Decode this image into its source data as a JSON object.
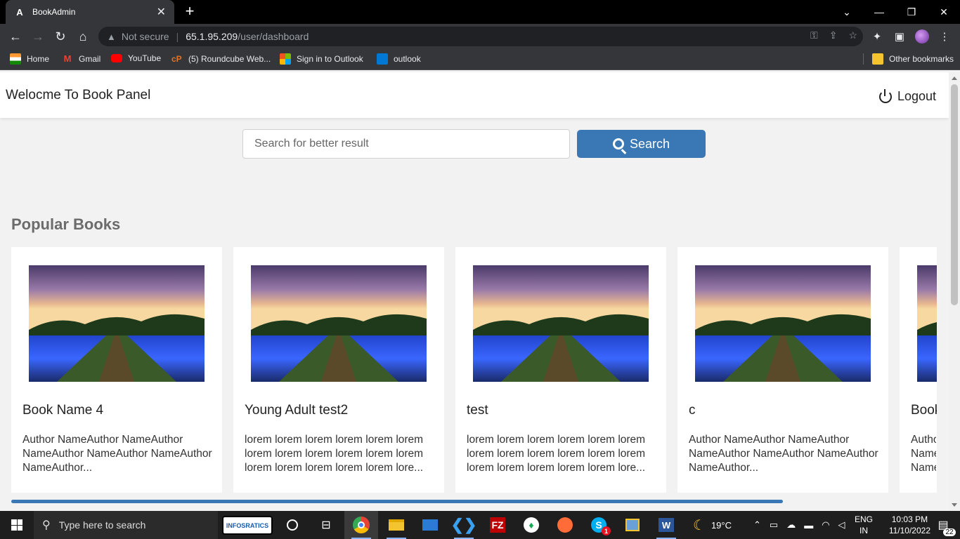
{
  "browser": {
    "tab_title": "BookAdmin",
    "tab_favicon": "A",
    "security_label": "Not secure",
    "url_host": "65.1.95.209",
    "url_path": "/user/dashboard",
    "bookmarks": [
      {
        "label": "Home",
        "color": "#ff9933"
      },
      {
        "label": "Gmail",
        "color": "#ea4335"
      },
      {
        "label": "YouTube",
        "color": "#ff0000"
      },
      {
        "label": "(5) Roundcube Web...",
        "color": "#e8711c"
      },
      {
        "label": "Sign in to Outlook",
        "color": "#00a4ef"
      },
      {
        "label": "outlook",
        "color": "#0078d4"
      }
    ],
    "other_bookmarks": "Other bookmarks"
  },
  "header": {
    "brand": "Welocme To Book Panel",
    "logout_label": "Logout"
  },
  "search": {
    "placeholder": "Search for better result",
    "button_label": "Search"
  },
  "section": {
    "title": "Popular Books"
  },
  "books": [
    {
      "name": "Book Name 4",
      "description": "Author NameAuthor NameAuthor NameAuthor NameAuthor NameAuthor NameAuthor..."
    },
    {
      "name": "Young Adult test2",
      "description": "lorem lorem lorem lorem lorem lorem lorem lorem lorem lorem lorem lorem lorem lorem lorem lorem lorem lore..."
    },
    {
      "name": "test",
      "description": "lorem lorem lorem lorem lorem lorem lorem lorem lorem lorem lorem lorem lorem lorem lorem lorem lorem lore..."
    },
    {
      "name": "c",
      "description": "Author NameAuthor NameAuthor NameAuthor NameAuthor NameAuthor NameAuthor..."
    },
    {
      "name": "Book",
      "description": "Autho Name Name"
    }
  ],
  "taskbar": {
    "search_placeholder": "Type here to search",
    "brand_badge": "INFOSRATICS",
    "weather": "19°C",
    "language_top": "ENG",
    "language_bottom": "IN",
    "time": "10:03 PM",
    "date": "11/10/2022",
    "notification_count": "22",
    "skype_badge": "1"
  },
  "colors": {
    "accent": "#3a78b5",
    "page_background": "#f2f2f2"
  }
}
